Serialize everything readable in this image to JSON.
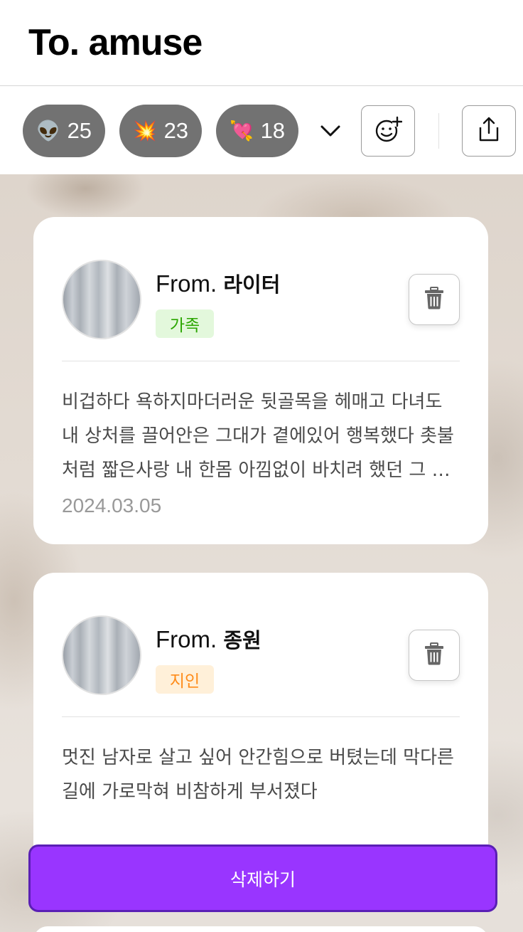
{
  "header": {
    "title": "To. amuse"
  },
  "reactions": [
    {
      "emoji": "👽",
      "icon": "alien-emoji-icon",
      "count": "25"
    },
    {
      "emoji": "💥",
      "icon": "collision-emoji-icon",
      "count": "23"
    },
    {
      "emoji": "💘",
      "icon": "heart-arrow-emoji-icon",
      "count": "18"
    }
  ],
  "toolbar": {
    "expand_icon": "chevron-down-icon",
    "add_reaction_icon": "add-emoji-icon",
    "share_icon": "share-icon"
  },
  "messages": [
    {
      "from_prefix": "From.",
      "name": "라이터",
      "relationship": "가족",
      "relationship_color": "#2ba600",
      "content": "비겁하다 욕하지마더러운 뒷골목을 헤매고 다녀도 내 상처를 끌어안은 그대가 곁에있어 행복했다 촛불처럼 짧은사랑 내 한몸 아낌없이 바치려 했던 그 사랑",
      "date": "2024.03.05"
    },
    {
      "from_prefix": "From.",
      "name": "종원",
      "relationship": "지인",
      "relationship_color": "#ff8c1a",
      "content": "멋진 남자로 살고 싶어 안간힘으로 버텼는데 막다른 길에 가로막혀 비참하게 부서졌다",
      "date": ""
    }
  ],
  "delete_button": {
    "label": "삭제하기",
    "color": "#9935ff"
  }
}
